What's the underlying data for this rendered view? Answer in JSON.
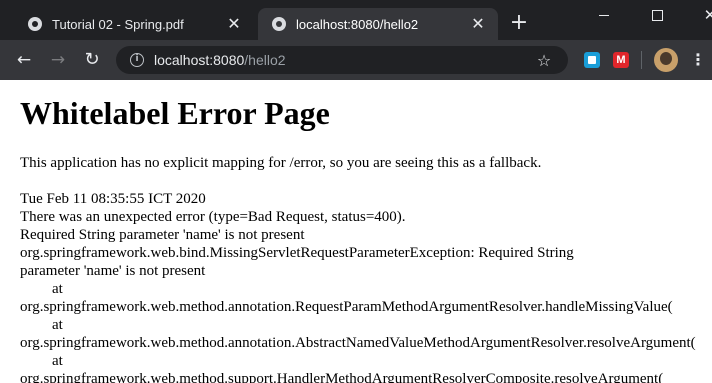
{
  "browser": {
    "tabs": [
      {
        "title": "Tutorial 02 - Spring.pdf",
        "active": false
      },
      {
        "title": "localhost:8080/hello2",
        "active": true
      }
    ],
    "new_tab_icon": "plus-icon",
    "address_bar": {
      "host": "localhost:8080",
      "path": "/hello2"
    }
  },
  "page": {
    "title": "Whitelabel Error Page",
    "fallback_text": "This application has no explicit mapping for /error, so you are seeing this as a fallback.",
    "details": [
      "Tue Feb 11 08:35:55 ICT 2020",
      "There was an unexpected error (type=Bad Request, status=400).",
      "Required String parameter 'name' is not present",
      "org.springframework.web.bind.MissingServletRequestParameterException: Required String",
      "parameter 'name' is not present",
      "at",
      "org.springframework.web.method.annotation.RequestParamMethodArgumentResolver.handleMissingValue(",
      "at",
      "org.springframework.web.method.annotation.AbstractNamedValueMethodArgumentResolver.resolveArgument(",
      "at",
      "org.springframework.web.method.support.HandlerMethodArgumentResolverComposite.resolveArgument("
    ]
  },
  "colors": {
    "tabstrip_bg": "#202124",
    "toolbar_bg": "#35363a",
    "omnibox_bg": "#202124"
  }
}
